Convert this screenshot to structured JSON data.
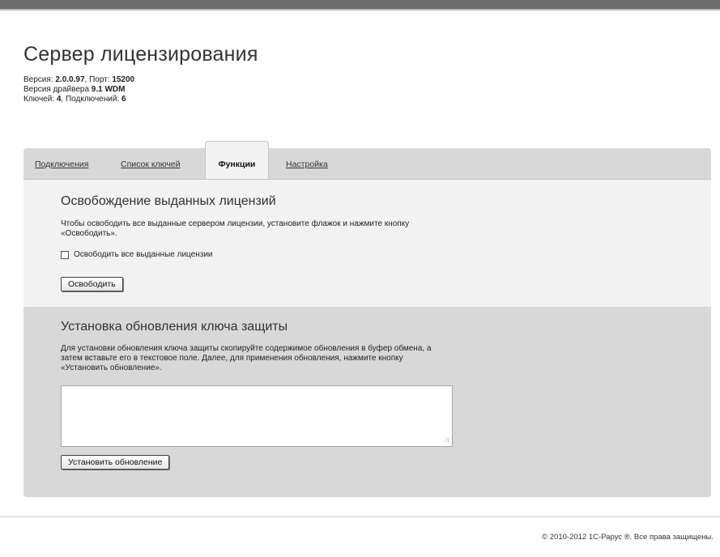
{
  "header": {
    "title": "Сервер лицензирования",
    "version_label": "Версия: ",
    "version_value": "2.0.0.97",
    "port_label": ", Порт: ",
    "port_value": "15200",
    "driver_label": "Версия драйвера ",
    "driver_value": "9.1 WDM",
    "keys_label": "Ключей: ",
    "keys_value": "4",
    "connections_label": ", Подключений: ",
    "connections_value": "6"
  },
  "tabs": [
    {
      "label": "Подключения",
      "active": false
    },
    {
      "label": "Список ключей",
      "active": false
    },
    {
      "label": "Функции",
      "active": true
    },
    {
      "label": "Настройка",
      "active": false
    }
  ],
  "release": {
    "title": "Освобождение выданных лицензий",
    "description_line1": "Чтобы освободить все выданные сервером лицензии, установите флажок и нажмите кнопку",
    "description_line2": "«Освободить».",
    "checkbox_label": "Освободить все выданные лицензии",
    "checkbox_checked": false,
    "button_label": "Освободить"
  },
  "update": {
    "title": "Установка обновления ключа защиты",
    "description_line1": "Для установки обновления ключа защиты скопируйте содержимое обновления в буфер обмена, а",
    "description_line2": "затем вставьте его в текстовое поле. Далее, для применения обновления, нажмите кнопку",
    "description_line3": "«Установить обновление».",
    "textarea_value": "",
    "button_label": "Установить обновление"
  },
  "footer": {
    "copyright": "© 2010-2012 1С-Рарус ®. Все права защищены."
  }
}
